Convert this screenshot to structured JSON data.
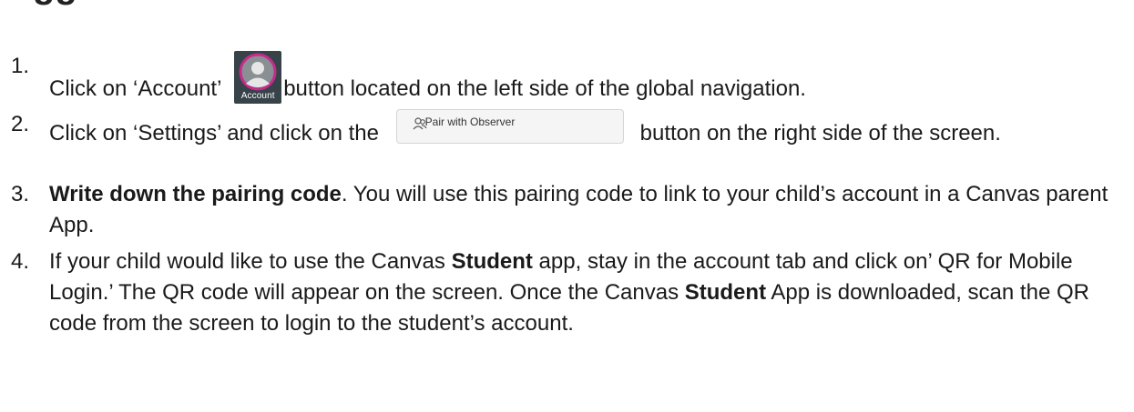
{
  "heading": {
    "text": "ggs"
  },
  "account_button": {
    "label": "Account",
    "icon": "user-avatar-icon",
    "background": "#374249",
    "ring": "#c72a8d"
  },
  "pair_button": {
    "label": "Pair with Observer",
    "icon": "users-icon"
  },
  "steps": [
    {
      "num": "1.",
      "text_before": "Click on ‘Account’",
      "text_after": "button located on the left side of the global navigation."
    },
    {
      "num": "2.",
      "text_before": "Click on ‘Settings’ and click on the",
      "text_after": "button on the right side of the screen."
    },
    {
      "num": "3.",
      "bold": "Write down the pairing code",
      "text": ". You will use this pairing code to link to your child’s account in a Canvas parent App."
    },
    {
      "num": "4.",
      "t1": "If your child would like to use the Canvas ",
      "b1": "Student",
      "t2": " app, stay in the account tab and click on’ QR for Mobile Login.’ The QR code will appear on the screen. Once the Canvas ",
      "b2": "Student",
      "t3": " App is downloaded, scan the QR code from the screen to login to the student’s account."
    }
  ]
}
